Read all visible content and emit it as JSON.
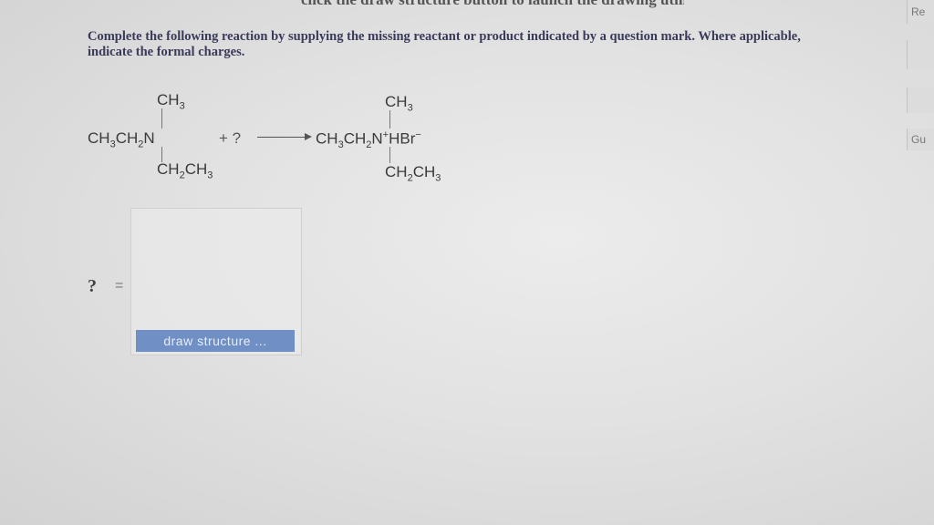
{
  "header": {
    "clipped_text": "click the draw structure button to launch the drawing utility."
  },
  "question": {
    "instructions": "Complete the following reaction by supplying the missing reactant or product indicated by a question mark. Where applicable, indicate the formal charges."
  },
  "reaction": {
    "reactant": {
      "top": "CH3",
      "left": "CH3CH2N",
      "bottom": "CH2CH3"
    },
    "plus_unknown": "+ ?",
    "product": {
      "top": "CH3",
      "left": "CH3CH2N",
      "counterion": "HBr",
      "bottom": "CH2CH3"
    }
  },
  "answer": {
    "question_mark": "?",
    "equals": "="
  },
  "actions": {
    "draw_structure_label": "draw structure ..."
  },
  "side_panel": {
    "tab1": "Re",
    "tab2": "Gu"
  }
}
